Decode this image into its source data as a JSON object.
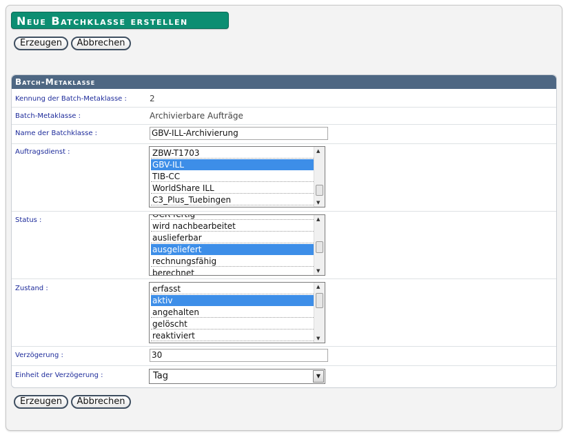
{
  "title": "Neue Batchklasse erstellen",
  "buttons": {
    "create": "Erzeugen",
    "cancel": "Abbrechen"
  },
  "section": {
    "header": "Batch-Metaklasse",
    "fields": {
      "id": {
        "label": "Kennung der Batch-Metaklasse",
        "value": "2"
      },
      "metaclass": {
        "label": "Batch-Metaklasse",
        "value": "Archivierbare Aufträge"
      },
      "name": {
        "label": "Name der Batchklasse",
        "value": "GBV-ILL-Archivierung"
      },
      "service": {
        "label": "Auftragsdienst",
        "options": [
          "ZBW-T1703",
          "GBV-ILL",
          "TIB-CC",
          "WorldShare ILL",
          "C3_Plus_Tuebingen"
        ],
        "selected": "GBV-ILL"
      },
      "status": {
        "label": "Status",
        "options": [
          "OCR fertig",
          "wird nachbearbeitet",
          "auslieferbar",
          "ausgeliefert",
          "rechnungsfähig",
          "berechnet"
        ],
        "selected": "ausgeliefert"
      },
      "state": {
        "label": "Zustand",
        "options": [
          "erfasst",
          "aktiv",
          "angehalten",
          "gelöscht",
          "reaktiviert"
        ],
        "selected": "aktiv"
      },
      "delay": {
        "label": "Verzögerung",
        "value": "30"
      },
      "delay_unit": {
        "label": "Einheit der Verzögerung",
        "value": "Tag"
      }
    }
  },
  "colors": {
    "title_bg": "#0d8e72",
    "section_header_bg": "#4e6783",
    "label_text": "#1c2a9a",
    "selection_bg": "#3d8ee8"
  }
}
